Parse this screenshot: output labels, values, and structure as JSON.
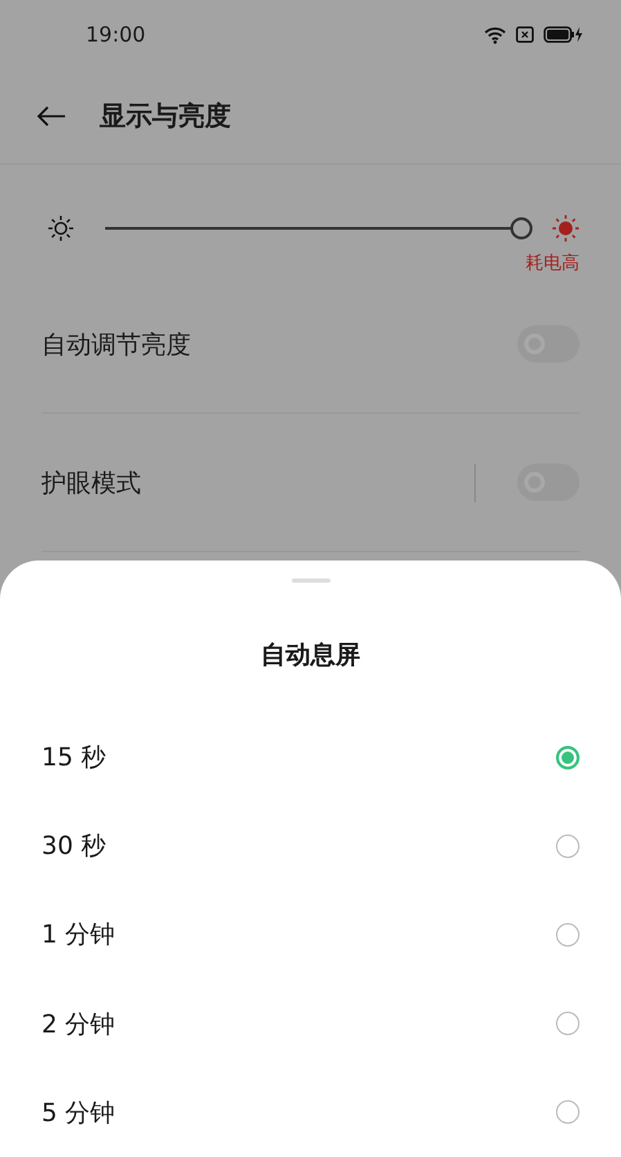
{
  "status_bar": {
    "time": "19:00"
  },
  "header": {
    "title": "显示与亮度"
  },
  "brightness": {
    "level": 1.0,
    "warning": "耗电高"
  },
  "settings": [
    {
      "label": "自动调节亮度",
      "on": false,
      "divider": false
    },
    {
      "label": "护眼模式",
      "on": false,
      "divider": true
    }
  ],
  "sheet": {
    "title": "自动息屏",
    "options": [
      {
        "label": "15 秒",
        "selected": true
      },
      {
        "label": "30 秒",
        "selected": false
      },
      {
        "label": "1 分钟",
        "selected": false
      },
      {
        "label": "2 分钟",
        "selected": false
      },
      {
        "label": "5 分钟",
        "selected": false
      }
    ]
  }
}
